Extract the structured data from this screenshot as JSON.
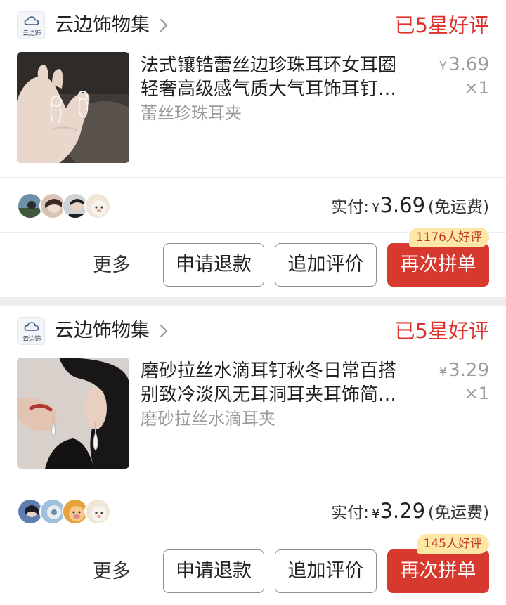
{
  "orders": [
    {
      "shop": {
        "logo_text": "云边饰",
        "name": "云边饰物集"
      },
      "rating_status": "已5星好评",
      "product": {
        "title_line1": "法式镶锆蕾丝边珍珠耳环女耳圈",
        "title_line2": "轻奢高级感气质大气耳饰耳钉…",
        "variant": "蕾丝珍珠耳夹",
        "price_symbol": "¥",
        "price": "3.69",
        "quantity": "×1"
      },
      "payment": {
        "label": "实付:",
        "symbol": "¥",
        "amount": "3.69",
        "shipping": "(免运费)"
      },
      "actions": {
        "more": "更多",
        "refund": "申请退款",
        "add_review": "追加评价",
        "rebuy": "再次拼单",
        "badge": "1176人好评"
      }
    },
    {
      "shop": {
        "logo_text": "云边饰",
        "name": "云边饰物集"
      },
      "rating_status": "已5星好评",
      "product": {
        "title_line1": "磨砂拉丝水滴耳钉秋冬日常百搭",
        "title_line2": "别致冷淡风无耳洞耳夹耳饰简…",
        "variant": "磨砂拉丝水滴耳夹",
        "price_symbol": "¥",
        "price": "3.29",
        "quantity": "×1"
      },
      "payment": {
        "label": "实付:",
        "symbol": "¥",
        "amount": "3.29",
        "shipping": "(免运费)"
      },
      "actions": {
        "more": "更多",
        "refund": "申请退款",
        "add_review": "追加评价",
        "rebuy": "再次拼单",
        "badge": "145人好评"
      }
    }
  ],
  "colors": {
    "accent_red": "#d8392e",
    "rating_red": "#e0322c",
    "badge_yellow": "#fde7a4",
    "muted_text": "#9a9a9a"
  },
  "icons": [
    "cloud-logo-icon",
    "chevron-right-icon"
  ]
}
